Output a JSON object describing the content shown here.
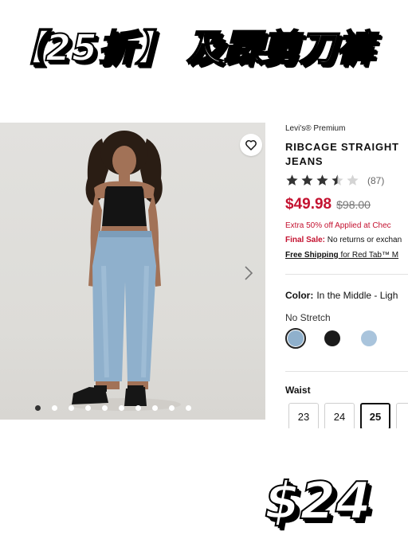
{
  "banner": {
    "headline": "【25折】 及踝剪刀裤",
    "price_sticker": "$24"
  },
  "product": {
    "brand": "Levi's® Premium",
    "title_line1": "RIBCAGE STRAIGHT",
    "title_line2": "JEANS",
    "rating": 3.5,
    "review_count": "(87)",
    "sale_price": "$49.98",
    "original_price": "$98.00",
    "promo_text": "Extra 50% off Applied at Chec",
    "final_sale_label": "Final Sale:",
    "final_sale_text": " No returns or exchan",
    "shipping_link": "Free Shipping",
    "shipping_text": " for Red Tab™ M",
    "color_label": "Color:",
    "color_value": "In the Middle - Ligh",
    "stretch_label": "No Stretch",
    "swatches": [
      {
        "name": "medium-wash",
        "color": "#8fb0cc",
        "selected": true
      },
      {
        "name": "black",
        "color": "#1b1b1b",
        "selected": false
      },
      {
        "name": "light-wash",
        "color": "#a9c4dc",
        "selected": false
      }
    ],
    "waist_label": "Waist",
    "sizes": [
      {
        "label": "23",
        "selected": false
      },
      {
        "label": "24",
        "selected": false
      },
      {
        "label": "25",
        "selected": true
      },
      {
        "label": "",
        "selected": false
      }
    ]
  },
  "gallery": {
    "dot_count": 10,
    "active_dot": 0
  },
  "colors": {
    "sale_red": "#c41230",
    "star": "#333333"
  }
}
